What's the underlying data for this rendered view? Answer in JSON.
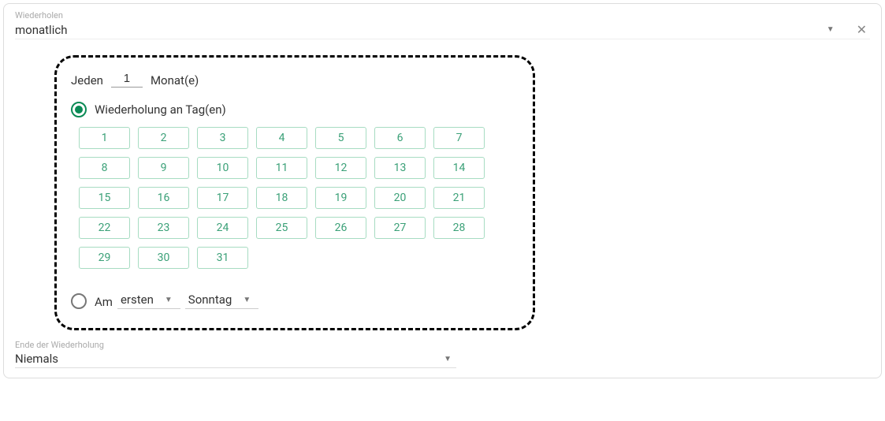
{
  "repeat": {
    "label": "Wiederholen",
    "value": "monatlich"
  },
  "interval": {
    "prefix": "Jeden",
    "value": "1",
    "suffix": "Monat(e)"
  },
  "repeatOnDays": {
    "label": "Wiederholung an Tag(en)",
    "days": [
      "1",
      "2",
      "3",
      "4",
      "5",
      "6",
      "7",
      "8",
      "9",
      "10",
      "11",
      "12",
      "13",
      "14",
      "15",
      "16",
      "17",
      "18",
      "19",
      "20",
      "21",
      "22",
      "23",
      "24",
      "25",
      "26",
      "27",
      "28",
      "29",
      "30",
      "31"
    ]
  },
  "onThe": {
    "prefix": "Am",
    "ordinal": "ersten",
    "weekday": "Sonntag"
  },
  "end": {
    "label": "Ende der Wiederholung",
    "value": "Niemals"
  }
}
